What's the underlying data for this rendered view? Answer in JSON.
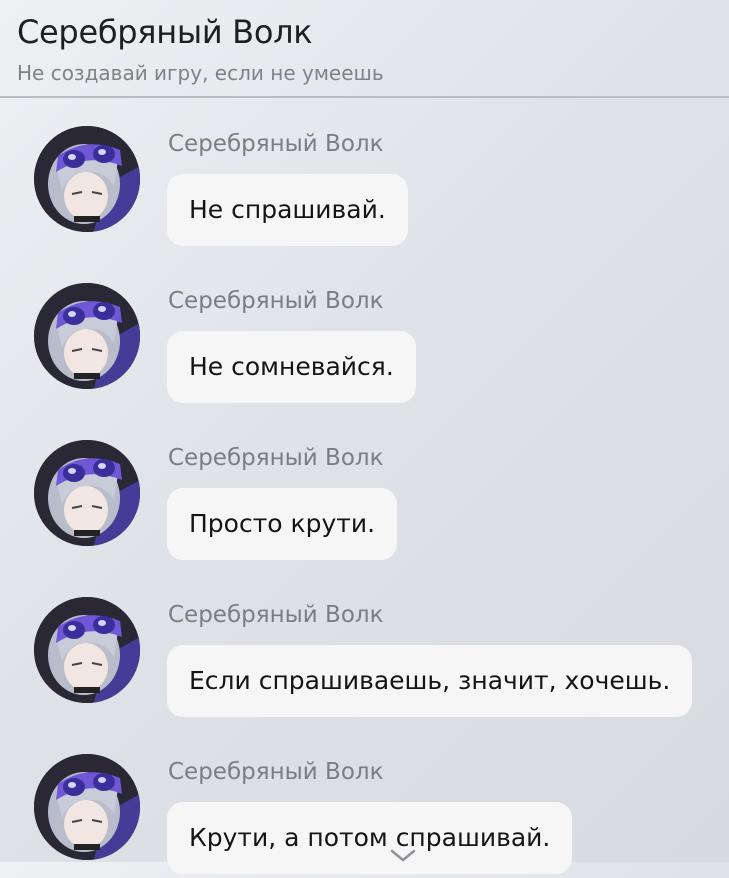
{
  "header": {
    "title": "Серебряный Волк",
    "subtitle": "Не создавай игру, если не умеешь"
  },
  "messages": [
    {
      "sender": "Серебряный Волк",
      "text": "Не спрашивай."
    },
    {
      "sender": "Серебряный Волк",
      "text": "Не сомневайся."
    },
    {
      "sender": "Серебряный Волк",
      "text": "Просто крути."
    },
    {
      "sender": "Серебряный Волк",
      "text": "Если спрашиваешь, значит, хочешь."
    },
    {
      "sender": "Серебряный Волк",
      "text": "Крути, а потом спрашивай."
    }
  ],
  "colors": {
    "bubble": "#f6f6f7",
    "sender": "#7b7d83",
    "hair": "#b9bccb",
    "goggles": "#6f57d6"
  },
  "icons": {
    "avatar": "silver-wolf-avatar",
    "scroll": "chevron-down-icon"
  }
}
